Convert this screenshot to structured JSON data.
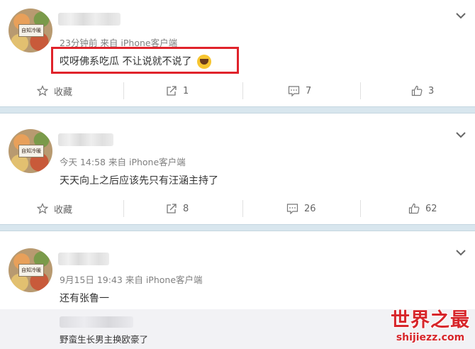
{
  "comments": [
    {
      "time": "23分钟前",
      "source": "来自 iPhone客户端",
      "text": "哎呀佛系吃瓜 不让说就不说了",
      "emoji": "laughing-emoji",
      "actions": {
        "collect": "收藏",
        "share": "1",
        "comment": "7",
        "like": "3"
      }
    },
    {
      "time": "今天 14:58",
      "source": "来自 iPhone客户端",
      "text": "天天向上之后应该先只有汪涵主持了",
      "actions": {
        "collect": "收藏",
        "share": "8",
        "comment": "26",
        "like": "62"
      }
    },
    {
      "time": "9月15日 19:43",
      "source": "来自 iPhone客户端",
      "text": "还有张鲁一",
      "reply": {
        "text": "野蛮生长男主换欧豪了"
      }
    }
  ],
  "watermark": {
    "main": "世界之最",
    "sub": "shijiezz.com"
  },
  "colors": {
    "highlight": "#e0232b",
    "separator": "#d8e6ee",
    "watermark": "#d7262b"
  }
}
